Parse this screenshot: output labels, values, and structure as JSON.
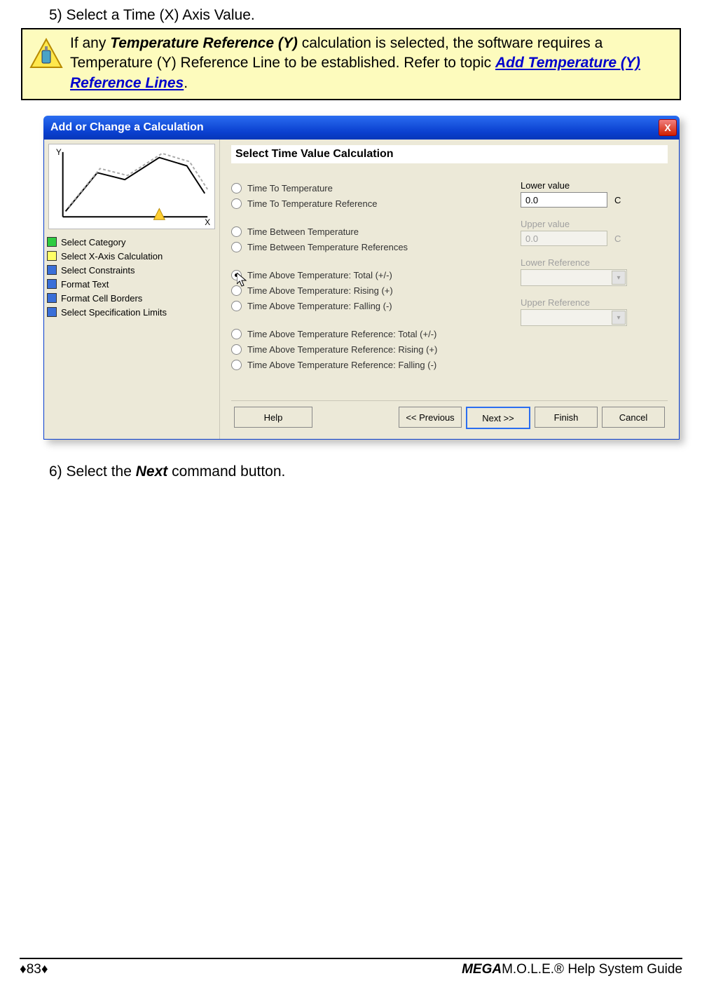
{
  "steps": {
    "s5": "5)  Select a Time (X) Axis Value.",
    "s6_pre": "6)  Select the ",
    "s6_bold": "Next",
    "s6_post": " command button."
  },
  "note": {
    "pre": "If any ",
    "bold1": "Temperature Reference (Y)",
    "mid": " calculation is selected, the software requires a Temperature (Y) Reference Line to be established. Refer to topic ",
    "link": "Add Temperature (Y) Reference Lines",
    "post": "."
  },
  "dialog": {
    "title": "Add or Change a Calculation",
    "close": "X",
    "nav": {
      "i0": "Select Category",
      "i1": "Select X-Axis Calculation",
      "i2": "Select Constraints",
      "i3": "Format Text",
      "i4": "Format Cell Borders",
      "i5": "Select Specification Limits"
    },
    "heading": "Select Time Value Calculation",
    "opts": {
      "o0": "Time To Temperature",
      "o1": "Time To Temperature Reference",
      "o2": "Time Between Temperature",
      "o3": "Time Between Temperature References",
      "o4": "Time Above Temperature: Total (+/-)",
      "o5": "Time Above Temperature: Rising (+)",
      "o6": "Time Above Temperature: Falling (-)",
      "o7": "Time Above Temperature Reference: Total (+/-)",
      "o8": "Time Above Temperature Reference: Rising (+)",
      "o9": "Time Above Temperature Reference: Falling (-)"
    },
    "vals": {
      "lower_label": "Lower value",
      "lower_value": "0.0",
      "lower_unit": "C",
      "upper_label": "Upper value",
      "upper_value": "0.0",
      "upper_unit": "C",
      "lower_ref": "Lower Reference",
      "upper_ref": "Upper Reference"
    },
    "buttons": {
      "help": "Help",
      "prev": "<< Previous",
      "next": "Next >>",
      "finish": "Finish",
      "cancel": "Cancel"
    }
  },
  "footer": {
    "page": "♦83♦",
    "title_b": "MEGA",
    "title_rest": "M.O.L.E.® Help System Guide"
  }
}
